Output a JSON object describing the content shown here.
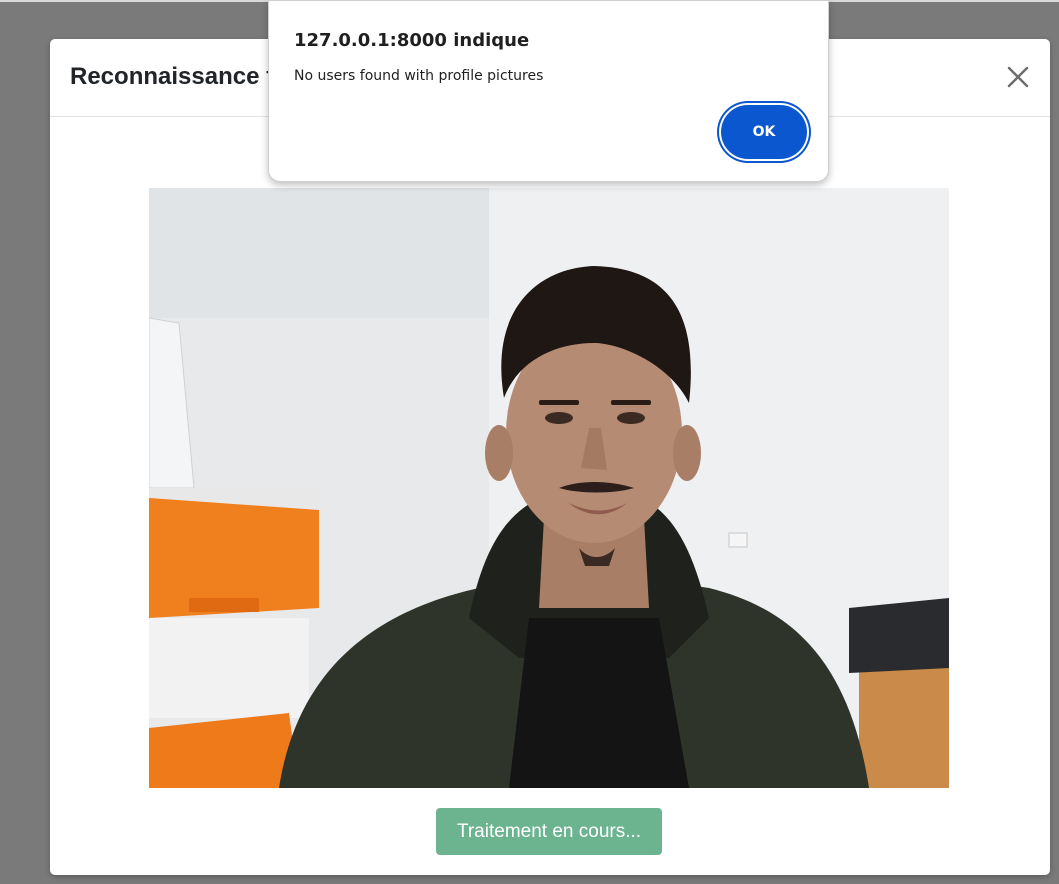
{
  "modal": {
    "title": "Reconnaissance faciale",
    "close_icon": "close-icon",
    "process_button_label": "Traitement en cours...",
    "process_button_color": "#6cb490"
  },
  "alert": {
    "title": "127.0.0.1:8000 indique",
    "message": "No users found with profile pictures",
    "ok_label": "OK",
    "ok_color": "#0b57d0"
  }
}
